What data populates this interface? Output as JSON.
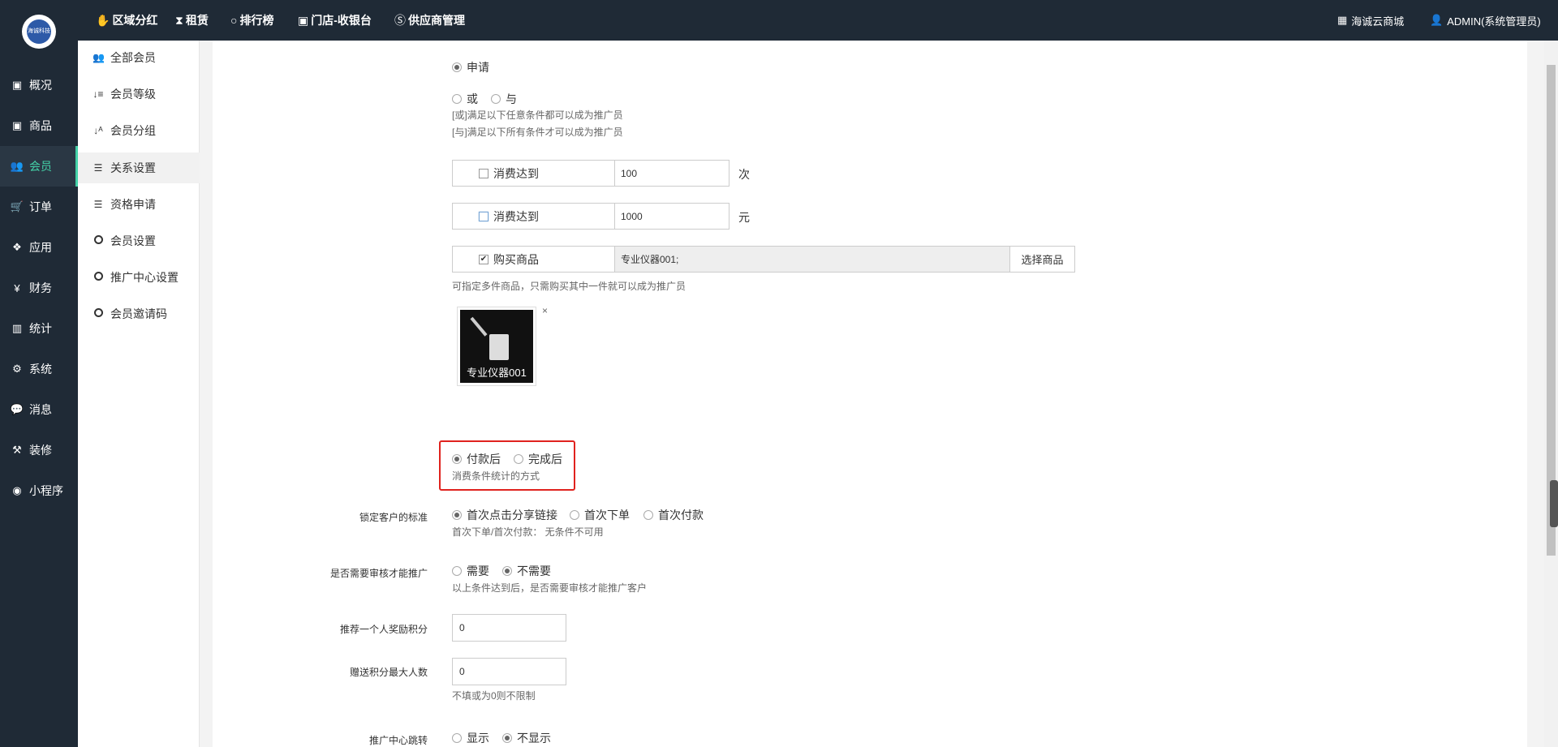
{
  "topnav": [
    {
      "icon": "hand-icon",
      "glyph": "✋",
      "label": "区域分红"
    },
    {
      "icon": "hourglass-icon",
      "glyph": "⧗",
      "label": "租赁"
    },
    {
      "icon": "circle-icon",
      "glyph": "○",
      "label": "排行榜"
    },
    {
      "icon": "register-icon",
      "glyph": "▣",
      "label": "门店-收银台"
    },
    {
      "icon": "skype-icon",
      "glyph": "Ⓢ",
      "label": "供应商管理"
    }
  ],
  "topright": {
    "store_label": "海诚云商城",
    "admin_label": "ADMIN(系统管理员)"
  },
  "logo_text": "海诚科技",
  "leftnav": [
    {
      "label": "概况"
    },
    {
      "label": "商品"
    },
    {
      "label": "会员"
    },
    {
      "label": "订单"
    },
    {
      "label": "应用"
    },
    {
      "label": "财务"
    },
    {
      "label": "统计"
    },
    {
      "label": "系统"
    },
    {
      "label": "消息"
    },
    {
      "label": "装修"
    },
    {
      "label": "小程序"
    }
  ],
  "subnav": [
    {
      "label": "全部会员"
    },
    {
      "label": "会员等级"
    },
    {
      "label": "会员分组"
    },
    {
      "label": "关系设置"
    },
    {
      "label": "资格申请"
    },
    {
      "label": "会员设置"
    },
    {
      "label": "推广中心设置"
    },
    {
      "label": "会员邀请码"
    }
  ],
  "form": {
    "apply_option": "申请",
    "logic_or": "或",
    "logic_and": "与",
    "hint_or": "[或]满足以下任意条件都可以成为推广员",
    "hint_and": "[与]满足以下所有条件才可以成为推广员",
    "cond1": {
      "label": "消费达到",
      "value": "100",
      "unit": "次"
    },
    "cond2": {
      "label": "消费达到",
      "value": "1000",
      "unit": "元"
    },
    "cond3": {
      "label": "购买商品",
      "value": "专业仪器001;",
      "button": "选择商品"
    },
    "cond3_hint": "可指定多件商品，只需购买其中一件就可以成为推广员",
    "product_caption": "专业仪器001",
    "remove_glyph": "×",
    "stat_after_pay": "付款后",
    "stat_after_complete": "完成后",
    "stat_hint": "消费条件统计的方式",
    "lock_label": "锁定客户的标准",
    "lock_opt1": "首次点击分享链接",
    "lock_opt2": "首次下单",
    "lock_opt3": "首次付款",
    "lock_hint": "首次下单/首次付款：  无条件不可用",
    "audit_label": "是否需要审核才能推广",
    "audit_yes": "需要",
    "audit_no": "不需要",
    "audit_hint": "以上条件达到后，是否需要审核才能推广客户",
    "reward_label": "推荐一个人奖励积分",
    "reward_value": "0",
    "maxpeople_label": "赠送积分最大人数",
    "maxpeople_value": "0",
    "maxpeople_hint": "不填或为0则不限制",
    "jump_label": "推广中心跳转",
    "jump_show": "显示",
    "jump_hide": "不显示"
  }
}
